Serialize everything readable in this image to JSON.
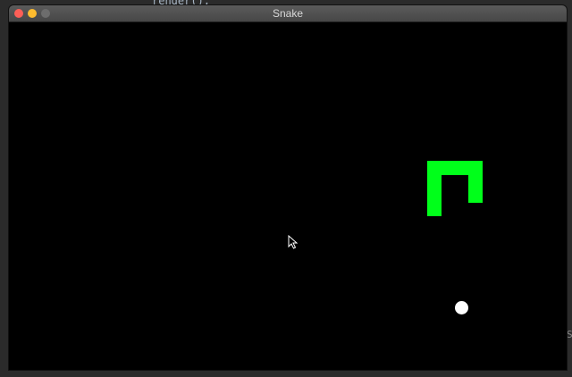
{
  "window": {
    "title": "Snake"
  },
  "editor_background": {
    "top_code": "render();",
    "right_edge_glyph": "S"
  },
  "game": {
    "snake_color": "#00ff1a",
    "food_color": "#ffffff",
    "background_color": "#000000"
  },
  "icons": [
    "close-button",
    "minimize-button",
    "zoom-button",
    "mouse-cursor-icon"
  ]
}
